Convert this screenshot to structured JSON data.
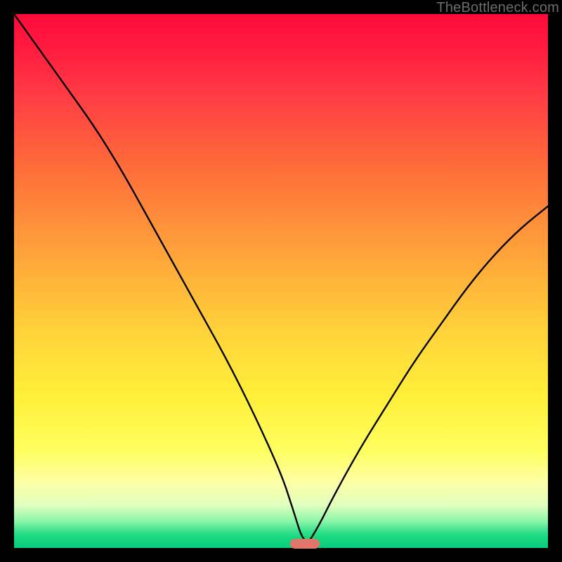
{
  "watermark": "TheBottleneck.com",
  "marker": {
    "x_frac": 0.545,
    "y_frac": 0.992
  },
  "chart_data": {
    "type": "line",
    "title": "",
    "xlabel": "",
    "ylabel": "",
    "xlim": [
      0,
      1
    ],
    "ylim": [
      0,
      1
    ],
    "series": [
      {
        "name": "bottleneck-curve",
        "x": [
          0.0,
          0.05,
          0.1,
          0.15,
          0.2,
          0.25,
          0.3,
          0.35,
          0.4,
          0.45,
          0.5,
          0.52,
          0.545,
          0.57,
          0.6,
          0.65,
          0.7,
          0.75,
          0.8,
          0.85,
          0.9,
          0.95,
          1.0
        ],
        "y": [
          1.0,
          0.93,
          0.86,
          0.79,
          0.71,
          0.62,
          0.53,
          0.44,
          0.35,
          0.25,
          0.14,
          0.08,
          0.0,
          0.04,
          0.1,
          0.19,
          0.27,
          0.35,
          0.42,
          0.49,
          0.55,
          0.6,
          0.64
        ]
      }
    ],
    "background_gradient": {
      "stops": [
        {
          "t": 0.0,
          "color": "#ff0a3a"
        },
        {
          "t": 0.28,
          "color": "#ff6a3a"
        },
        {
          "t": 0.6,
          "color": "#ffd43a"
        },
        {
          "t": 0.82,
          "color": "#ffff62"
        },
        {
          "t": 0.95,
          "color": "#8cf5a8"
        },
        {
          "t": 1.0,
          "color": "#0acb7f"
        }
      ]
    }
  }
}
